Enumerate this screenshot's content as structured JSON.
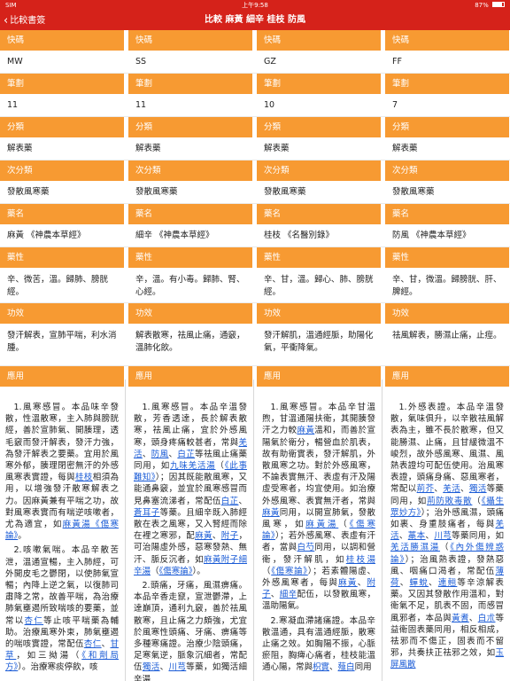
{
  "status": {
    "carrier": "SIM",
    "time": "上午9:58",
    "battery": "87%",
    "battery_level": 0.87
  },
  "nav": {
    "back_label": "比較書簽",
    "title": "比較 麻黃 細辛 桂枝 防風"
  },
  "labels": {
    "code": "快碼",
    "strokes": "筆劃",
    "category": "分類",
    "subcategory": "次分類",
    "name": "藥名",
    "nature": "藥性",
    "effect": "功效",
    "usage": "應用"
  },
  "herbs": [
    {
      "code": "MW",
      "strokes": "11",
      "category": "解表藥",
      "subcategory": "發散風寒藥",
      "name": "麻黃 《神農本草經》",
      "nature": "辛、微苦，溫。歸肺、膀胱經。",
      "effect": "發汗解表，宣肺平喘，利水消腫。",
      "usage_p1": "1.風寒感冒。本品味辛發散，性溫散寒，主入肺與膀胱經，善於宣肺氣、開腠理，透毛竅而發汗解表，發汗力強，為發汗解表之要藥。宜用於風寒外郁，腠理閉密無汗的外感風寒表實證，每與",
      "usage_link1": "桂枝",
      "usage_p1b": "相須為用，以增強發汗散寒解表之力。因麻黃兼有平喘之功，故對風寒表實而有喘逆咳嗽者，尤為適宜，如",
      "usage_link2": "麻黃湯",
      "usage_link3": "《傷寒論》",
      "usage_p1c": "。",
      "usage_p2": "2.咳嗽氣喘。本品辛散苦泄，溫通宣暢，主入肺經，可外開皮毛之鬱閉，以使肺氣宣暢；內降上逆之氣，以復肺司肅降之常，故善平喘，為治療肺氣壅遏所致喘咳的要藥，並常以",
      "usage_link4": "杏仁",
      "usage_p2b": "等止咳平喘藥為輔助。治療風寒外束，肺氣壅遏的喘咳實證，常配伍",
      "usage_link5": "杏仁",
      "usage_p2c": "、",
      "usage_link6": "甘草",
      "usage_p2d": "，如三拗湯（",
      "usage_link7": "《和劑局方》",
      "usage_p2e": "）。治療寒痰停飲，咳"
    },
    {
      "code": "SS",
      "strokes": "11",
      "category": "解表藥",
      "subcategory": "發散風寒藥",
      "name": "細辛 《神農本草經》",
      "nature": "辛，溫。有小毒。歸肺、腎、心經。",
      "effect": "解表散寒，祛風止痛，通竅，溫肺化飲。",
      "usage_p1": "1.風寒感冒。本品辛溫發散，芳香透達，長於解表散寒，祛風止痛，宜於外感風寒，頭身疼痛較甚者，常與",
      "usage_link1": "羌活",
      "usage_p1b": "、",
      "usage_link2": "防風",
      "usage_p1c": "、",
      "usage_link3": "白芷",
      "usage_p1d": "等祛風止痛藥同用，如",
      "usage_link4": "九味羌活湯",
      "usage_p1e": "（",
      "usage_link5": "《此事難知》",
      "usage_p1f": "）；因其既能散風寒，又能通鼻竅，並宜於風寒感冒而見鼻塞流涕者，常配伍",
      "usage_link6": "白芷",
      "usage_p1g": "、",
      "usage_link7": "蒼耳子",
      "usage_p1h": "等藥。且細辛既入肺經散在表之風寒，又入腎經而除在裡之寒邪，配",
      "usage_link8": "麻黃",
      "usage_p1i": "、",
      "usage_link9": "附子",
      "usage_p1j": "，可治陽虛外感，惡寒發熱、無汗、脈反沉者，如",
      "usage_link10": "麻黃附子細辛湯",
      "usage_p1k": "（",
      "usage_link11": "《傷寒論》",
      "usage_p1l": "）。",
      "usage_p2": "2.頭痛，牙痛，風濕痹痛。本品辛香走竄，宣泄鬱滯，上達巔頂，通利九竅，善於祛風散寒，且止痛之力頗強，尤宜於風寒性頭痛、牙痛、痹痛等多種寒痛證。治療少陰頭痛，足寒氣逆，脈象沉細者，常配伍",
      "usage_link12": "獨活",
      "usage_p2b": "、",
      "usage_link13": "川芎",
      "usage_p2c": "等藥，如獨活細辛湯"
    },
    {
      "code": "GZ",
      "strokes": "10",
      "category": "解表藥",
      "subcategory": "發散風寒藥",
      "name": "桂枝 《名醫別錄》",
      "nature": "辛、甘，溫。歸心、肺、膀胱經。",
      "effect": "發汗解肌，溫通經脈，助陽化氣，平衝降氣。",
      "usage_p1": "1.風寒感冒。本品辛甘溫煦，甘溫通陽扶衛，其開腠發汗之力較",
      "usage_link1": "麻黃",
      "usage_p1b": "溫和，而善於宣陽氣於衛分，暢營血於肌表，故有助衛實表，發汗解肌，外散風寒之功。對於外感風寒，不論表實無汗、表虛有汗及陽虛受寒者，均宜使用。如治療外感風寒、表實無汗者，常與",
      "usage_link2": "麻黃",
      "usage_p1c": "同用，以開宣肺氣，發散風寒，如",
      "usage_link3": "麻黃湯",
      "usage_p1d": "（",
      "usage_link4": "《傷寒論》",
      "usage_p1e": "）；若外感風寒、表虛有汗者，當與",
      "usage_link5": "白芍",
      "usage_p1f": "同用，以調和營衛，發汗解肌，如",
      "usage_link6": "桂枝湯",
      "usage_p1g": "（",
      "usage_link7": "《傷寒論》",
      "usage_p1h": "）；若素體陽虛、外感風寒者，每與",
      "usage_link8": "麻黃",
      "usage_p1i": "、",
      "usage_link9": "附子",
      "usage_p1j": "、",
      "usage_link10": "細辛",
      "usage_p1k": "配伍，以發散風寒，溫助陽氣。",
      "usage_p2": "2.寒凝血滯諸痛證。本品辛散溫通，具有溫通經脈，散寒止痛之效。如胸陽不振，心脈瘀阻，胸痺心痛者，桂枝能溫通心陽，常與",
      "usage_link11": "枳實",
      "usage_p2b": "、",
      "usage_link12": "薤白",
      "usage_p2c": "同用"
    },
    {
      "code": "FF",
      "strokes": "7",
      "category": "解表藥",
      "subcategory": "發散風寒藥",
      "name": "防風 《神農本草經》",
      "nature": "辛、甘，微溫。歸膀胱、肝、脾經。",
      "effect": "祛風解表，勝濕止痛，止痙。",
      "usage_p1": "1.外感表證。本品辛溫發散，氣味俱升，以辛散祛風解表為主，雖不長於散寒，但又能勝濕、止痛，且甘緩微溫不峻烈，故外感風寒、風濕、風熱表證均可配伍使用。治風寒表證，頭痛身痛、惡風寒者，常配以",
      "usage_link1": "荊芥",
      "usage_p1b": "、",
      "usage_link2": "羌活",
      "usage_p1c": "、",
      "usage_link3": "獨活",
      "usage_p1d": "等藥同用，如",
      "usage_link4": "荊防敗毒散",
      "usage_p1e": "（",
      "usage_link5": "《攝生眾妙方》",
      "usage_p1f": "）；治外感風濕，頭痛如裹、身重肢痛者，每與",
      "usage_link6": "羌活",
      "usage_p1g": "、",
      "usage_link7": "藁本",
      "usage_p1h": "、",
      "usage_link8": "川芎",
      "usage_p1i": "等藥同用，如",
      "usage_link9": "羌活勝濕湯",
      "usage_p1j": "（",
      "usage_link10": "《內外傷辨惑論》",
      "usage_p1k": "）；治風熱表證，發熱惡風、咽痛口渴者，常配伍",
      "usage_link11": "薄荷",
      "usage_p1l": "、",
      "usage_link12": "蟬蛻",
      "usage_p1m": "、",
      "usage_link13": "連翹",
      "usage_p1n": "等辛涼解表藥。又因其發散作用溫和，對衛氣不足，肌表不固，而感冒風邪者，本品與",
      "usage_link14": "黃耆",
      "usage_p1o": "、",
      "usage_link15": "白朮",
      "usage_p1p": "等益衛固表藥同用，相反相成，祛邪而不傷正，固表而不留邪，共奏扶正祛邪之效，如",
      "usage_link16": "玉屏風散",
      "usage_p1q": ""
    }
  ]
}
